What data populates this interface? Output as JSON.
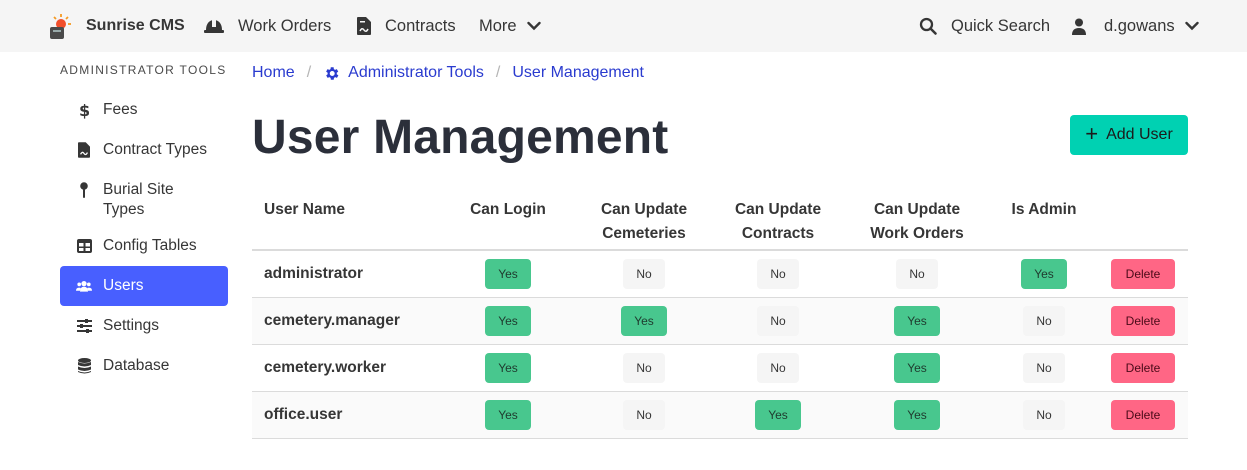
{
  "navbar": {
    "brand": "Sunrise CMS",
    "work_orders": "Work Orders",
    "contracts": "Contracts",
    "more": "More",
    "quick_search": "Quick Search",
    "username": "d.gowans",
    "logo_colors": {
      "sun": "#f14e2b",
      "base": "#4a4a4a"
    }
  },
  "sidebar": {
    "label": "Administrator Tools",
    "items": [
      {
        "label": "Fees",
        "icon": "dollar-icon"
      },
      {
        "label": "Contract Types",
        "icon": "file-contract-icon"
      },
      {
        "label": "Burial Site Types",
        "icon": "map-pin-icon"
      },
      {
        "label": "Config Tables",
        "icon": "table-icon"
      },
      {
        "label": "Users",
        "icon": "users-icon",
        "active": true
      },
      {
        "label": "Settings",
        "icon": "sliders-icon"
      },
      {
        "label": "Database",
        "icon": "database-icon"
      }
    ]
  },
  "breadcrumb": {
    "home": "Home",
    "admin": "Administrator Tools",
    "current": "User Management"
  },
  "page": {
    "title": "User Management",
    "add_button": "Add User"
  },
  "table": {
    "headers": [
      "User Name",
      "Can Login",
      "Can Update\nCemeteries",
      "Can Update\nContracts",
      "Can Update\nWork Orders",
      "Is Admin"
    ],
    "delete_label": "Delete",
    "rows": [
      {
        "name": "administrator",
        "values": [
          "Yes",
          "No",
          "No",
          "No",
          "Yes"
        ]
      },
      {
        "name": "cemetery.manager",
        "values": [
          "Yes",
          "Yes",
          "No",
          "Yes",
          "No"
        ]
      },
      {
        "name": "cemetery.worker",
        "values": [
          "Yes",
          "No",
          "No",
          "Yes",
          "No"
        ]
      },
      {
        "name": "office.user",
        "values": [
          "Yes",
          "No",
          "Yes",
          "Yes",
          "No"
        ]
      }
    ]
  },
  "colors": {
    "accent": "#485fff",
    "success": "#48c78e",
    "danger": "#ff6685",
    "primary": "#00d1b2",
    "link": "#2a3bcf"
  }
}
